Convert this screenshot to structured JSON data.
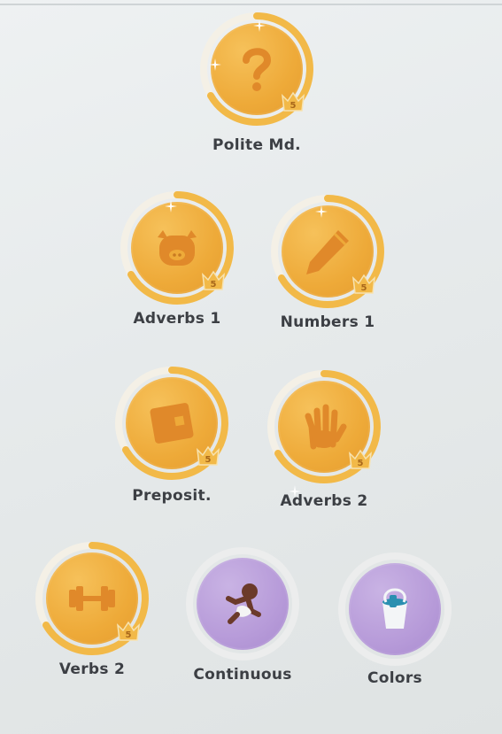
{
  "skills": [
    {
      "label": "Polite Md.",
      "crown": "5",
      "icon": "question-mark-icon",
      "color": "#eeaa39"
    },
    {
      "label": "Adverbs 1",
      "crown": "5",
      "icon": "pig-icon",
      "color": "#eeaa39"
    },
    {
      "label": "Numbers 1",
      "crown": "5",
      "icon": "pencil-icon",
      "color": "#eeaa39"
    },
    {
      "label": "Preposit.",
      "crown": "5",
      "icon": "box-icon",
      "color": "#eeaa39"
    },
    {
      "label": "Adverbs 2",
      "crown": "5",
      "icon": "hand-icon",
      "color": "#eeaa39"
    },
    {
      "label": "Verbs 2",
      "crown": "5",
      "icon": "dumbbell-icon",
      "color": "#eeaa39"
    },
    {
      "label": "Continuous",
      "icon": "running-child-icon",
      "color": "#b79bd9"
    },
    {
      "label": "Colors",
      "icon": "paint-bucket-icon",
      "color": "#b79bd9"
    }
  ]
}
